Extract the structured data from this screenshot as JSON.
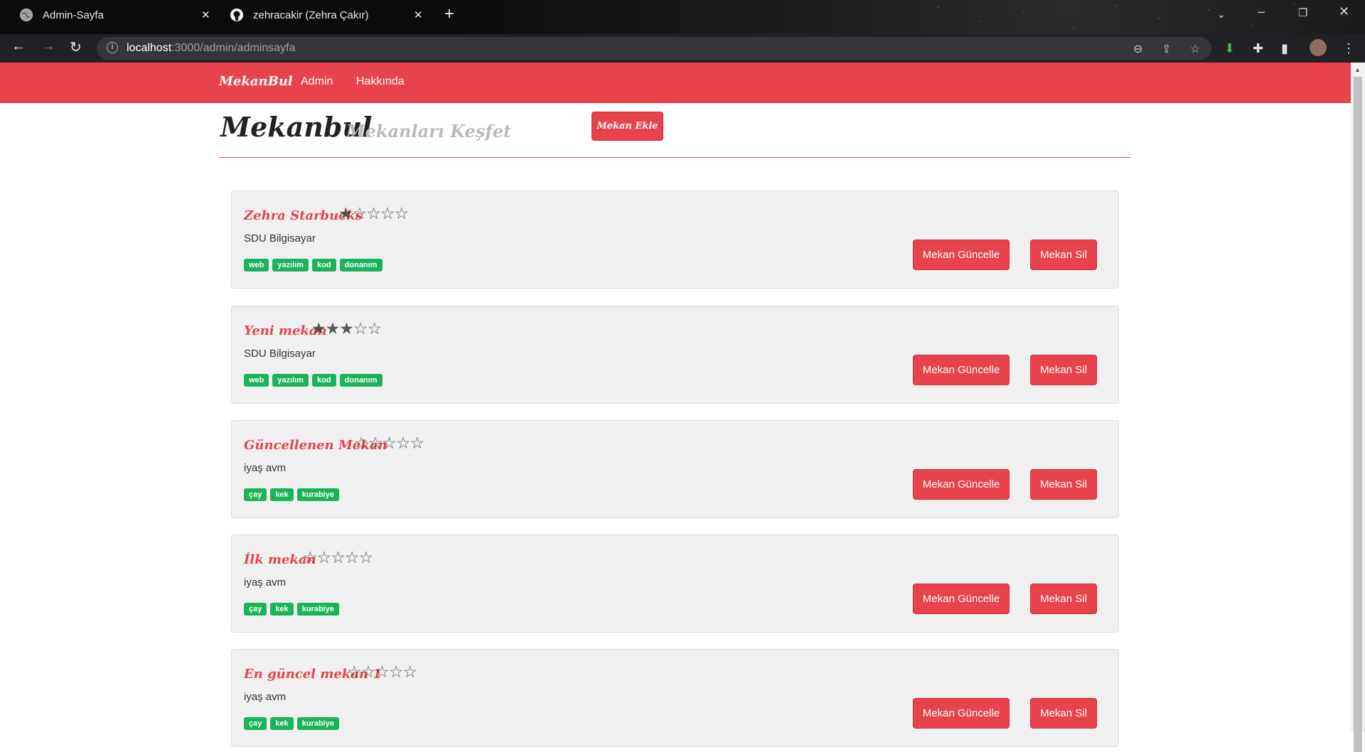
{
  "browser": {
    "tabs": [
      {
        "title": "Admin-Sayfa"
      },
      {
        "title": "zehracakir (Zehra Çakır)"
      }
    ],
    "url_host": "localhost",
    "url_path": ":3000/admin/adminsayfa"
  },
  "navbar": {
    "brand": "MekanBul",
    "links": [
      "Admin",
      "Hakkında"
    ]
  },
  "header": {
    "title": "Mekanbul",
    "subtitle": "Mekanları Keşfet",
    "add_button": "Mekan Ekle"
  },
  "buttons": {
    "update": "Mekan Güncelle",
    "delete": "Mekan Sil"
  },
  "venues": [
    {
      "name": "Zehra Starbucks",
      "stars": "★☆☆☆☆",
      "rating": 1,
      "address": "SDU Bilgisayar",
      "tags": [
        "web",
        "yazılım",
        "kod",
        "donanım"
      ]
    },
    {
      "name": "Yeni mekan",
      "stars": "★★★☆☆",
      "rating": 3,
      "address": "SDU Bilgisayar",
      "tags": [
        "web",
        "yazılım",
        "kod",
        "donanım"
      ]
    },
    {
      "name": "Güncellenen Mekan",
      "stars": "☆☆☆☆☆",
      "rating": 0,
      "address": "iyaş avm",
      "tags": [
        "çay",
        "kek",
        "kurabiye"
      ]
    },
    {
      "name": "İlk mekan",
      "stars": "☆☆☆☆☆",
      "rating": 0,
      "address": "iyaş avm",
      "tags": [
        "çay",
        "kek",
        "kurabiye"
      ]
    },
    {
      "name": "En güncel mekan 1",
      "stars": "☆☆☆☆☆",
      "rating": 0,
      "address": "iyaş avm",
      "tags": [
        "çay",
        "kek",
        "kurabiye"
      ]
    }
  ]
}
